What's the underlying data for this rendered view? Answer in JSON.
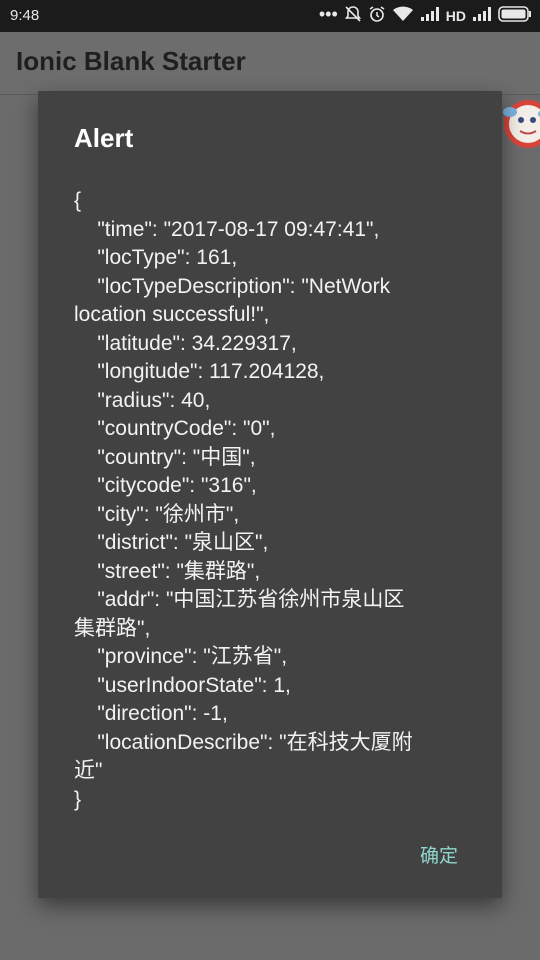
{
  "status_bar": {
    "time": "9:48",
    "network_label": "HD",
    "icons": [
      "more-dots-icon",
      "alarm-off-icon",
      "alarm-icon",
      "wifi-icon",
      "signal-icon",
      "signal-icon-2",
      "battery-icon"
    ]
  },
  "header": {
    "title": "Ionic Blank Starter"
  },
  "alert": {
    "title": "Alert",
    "message": "{\n    \"time\": \"2017-08-17 09:47:41\",\n    \"locType\": 161,\n    \"locTypeDescription\": \"NetWork\nlocation successful!\",\n    \"latitude\": 34.229317,\n    \"longitude\": 117.204128,\n    \"radius\": 40,\n    \"countryCode\": \"0\",\n    \"country\": \"中国\",\n    \"citycode\": \"316\",\n    \"city\": \"徐州市\",\n    \"district\": \"泉山区\",\n    \"street\": \"集群路\",\n    \"addr\": \"中国江苏省徐州市泉山区\n集群路\",\n    \"province\": \"江苏省\",\n    \"userIndoorState\": 1,\n    \"direction\": -1,\n    \"locationDescribe\": \"在科技大厦附\n近\"\n}",
    "ok_label": "确定"
  },
  "colors": {
    "status_bar": "#1b1b1b",
    "dialog_bg": "#424242",
    "accent": "#8fd7cf",
    "overlay_bg": "#6b6b6b"
  }
}
